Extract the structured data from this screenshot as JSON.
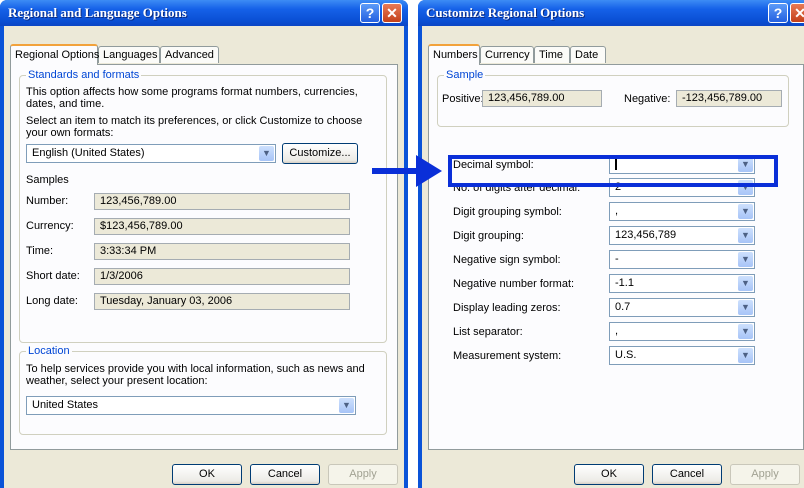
{
  "left_window": {
    "title": "Regional and Language Options",
    "tabs": [
      "Regional Options",
      "Languages",
      "Advanced"
    ],
    "standards": {
      "group_label": "Standards and formats",
      "description": "This option affects how some programs format numbers, currencies, dates, and time.",
      "instruction": "Select an item to match its preferences, or click Customize to choose your own formats:",
      "selected_format": "English (United States)",
      "customize_label": "Customize...",
      "samples_label": "Samples",
      "samples": [
        {
          "label": "Number:",
          "value": "123,456,789.00"
        },
        {
          "label": "Currency:",
          "value": "$123,456,789.00"
        },
        {
          "label": "Time:",
          "value": "3:33:34 PM"
        },
        {
          "label": "Short date:",
          "value": "1/3/2006"
        },
        {
          "label": "Long date:",
          "value": "Tuesday, January 03, 2006"
        }
      ]
    },
    "location": {
      "group_label": "Location",
      "description": "To help services provide you with local information, such as news and weather, select your present location:",
      "value": "United States"
    },
    "buttons": {
      "ok": "OK",
      "cancel": "Cancel",
      "apply": "Apply"
    }
  },
  "right_window": {
    "title": "Customize Regional Options",
    "tabs": [
      "Numbers",
      "Currency",
      "Time",
      "Date"
    ],
    "sample": {
      "group_label": "Sample",
      "positive_label": "Positive:",
      "positive_value": "123,456,789.00",
      "negative_label": "Negative:",
      "negative_value": "-123,456,789.00"
    },
    "settings": [
      {
        "label": "Decimal symbol:",
        "value": ""
      },
      {
        "label": "No. of digits after decimal:",
        "value": "2"
      },
      {
        "label": "Digit grouping symbol:",
        "value": ","
      },
      {
        "label": "Digit grouping:",
        "value": "123,456,789"
      },
      {
        "label": "Negative sign symbol:",
        "value": "-"
      },
      {
        "label": "Negative number format:",
        "value": "-1.1"
      },
      {
        "label": "Display leading zeros:",
        "value": "0.7"
      },
      {
        "label": "List separator:",
        "value": ","
      },
      {
        "label": "Measurement system:",
        "value": "U.S."
      }
    ],
    "buttons": {
      "ok": "OK",
      "cancel": "Cancel",
      "apply": "Apply"
    }
  },
  "colors": {
    "highlight": "#0a2fd8",
    "title_bar": "#0a53d8",
    "dialog_bg": "#ece9d8",
    "group_label": "#0046d5"
  },
  "icons": [
    "help-icon",
    "close-icon",
    "dropdown-arrow-icon",
    "arrow-right-icon"
  ]
}
